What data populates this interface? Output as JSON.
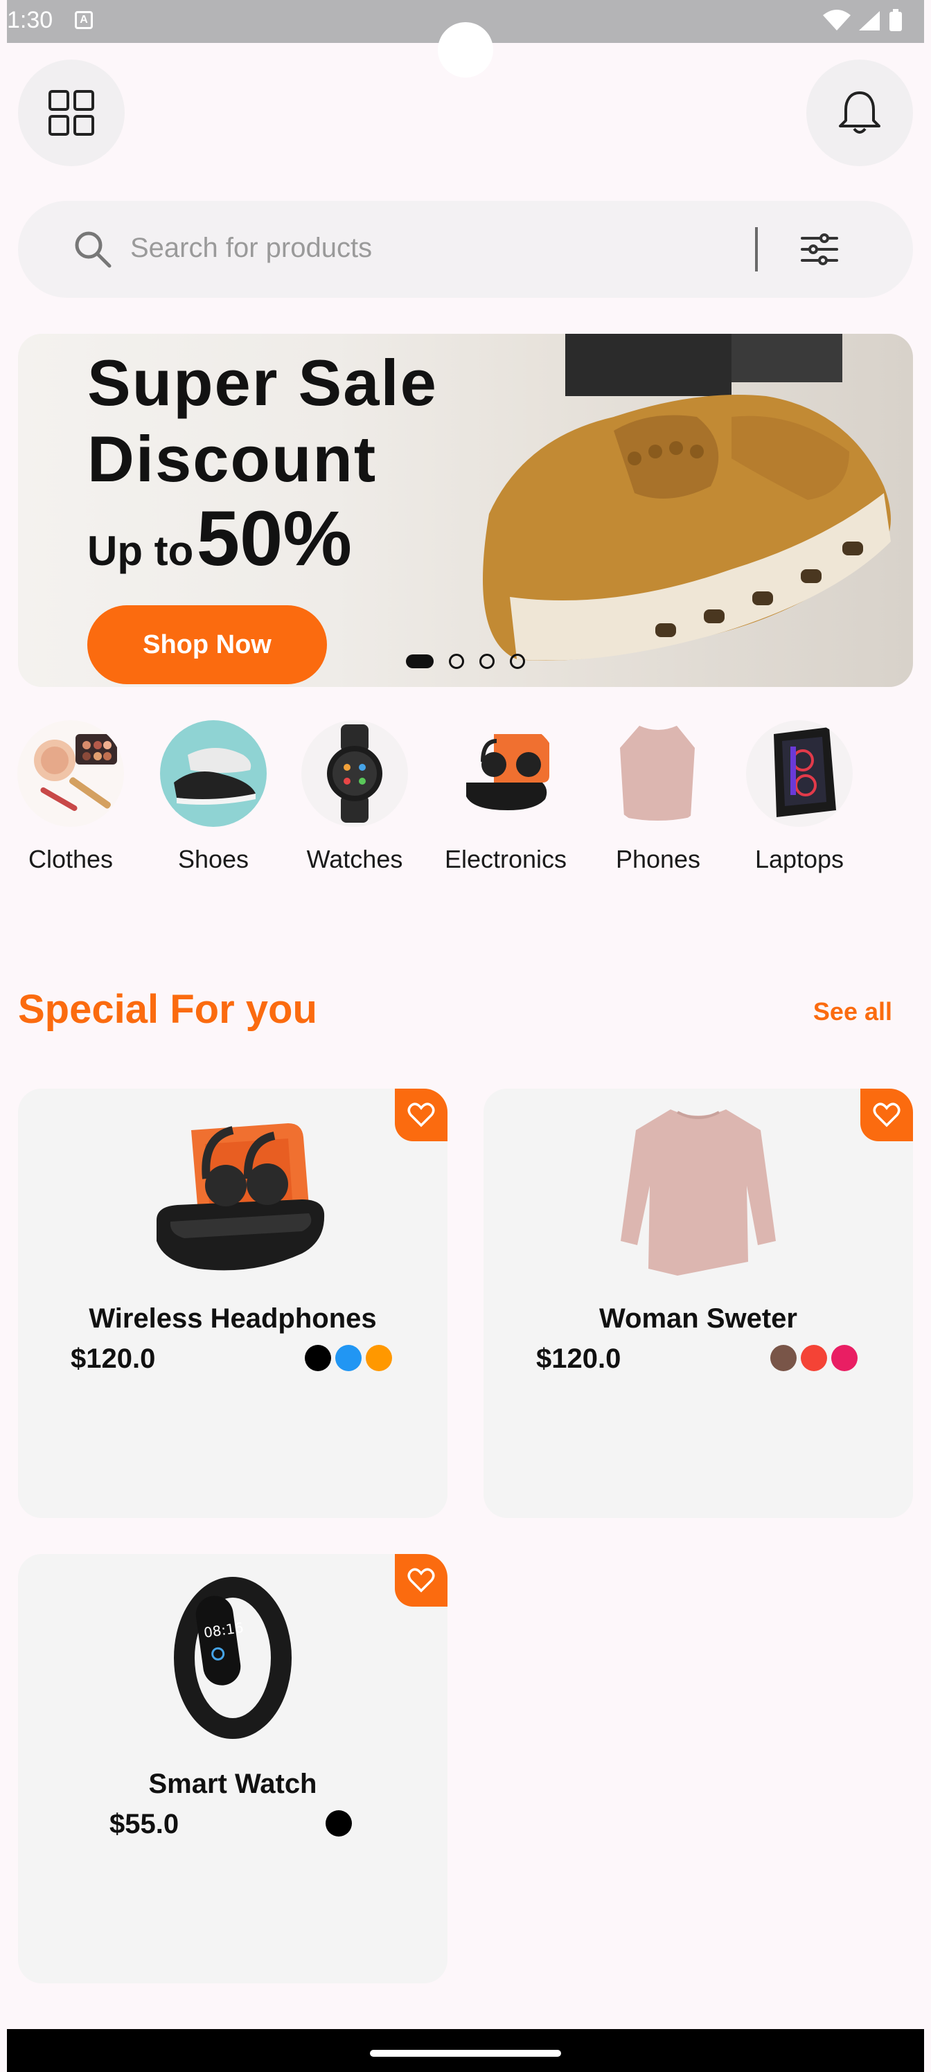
{
  "status": {
    "time": "1:30",
    "indicator": "A"
  },
  "header": {
    "menu_icon": "grid-icon",
    "bell_icon": "bell-icon"
  },
  "search": {
    "placeholder": "Search for products",
    "icon": "search-icon",
    "filter_icon": "sliders-icon"
  },
  "banner": {
    "line1": "Super Sale",
    "line2": "Discount",
    "line3_prefix": "Up to",
    "line3_value": "50%",
    "button": "Shop Now",
    "slides": 4,
    "active_slide": 1
  },
  "categories": [
    {
      "label": "Clothes"
    },
    {
      "label": "Shoes"
    },
    {
      "label": "Watches"
    },
    {
      "label": "Electronics"
    },
    {
      "label": "Phones"
    },
    {
      "label": "Laptops"
    }
  ],
  "section": {
    "title": "Special For you",
    "see_all": "See all"
  },
  "products": [
    {
      "name": "Wireless Headphones",
      "price": "$120.0",
      "colors": [
        "#000000",
        "#2196f3",
        "#ff9800"
      ]
    },
    {
      "name": "Woman Sweter",
      "price": "$120.0",
      "colors": [
        "#795548",
        "#f44336",
        "#e91e63"
      ]
    },
    {
      "name": "Smart Watch",
      "price": "$55.0",
      "colors": [
        "#000000"
      ]
    }
  ],
  "accent": "#fb6b0f"
}
